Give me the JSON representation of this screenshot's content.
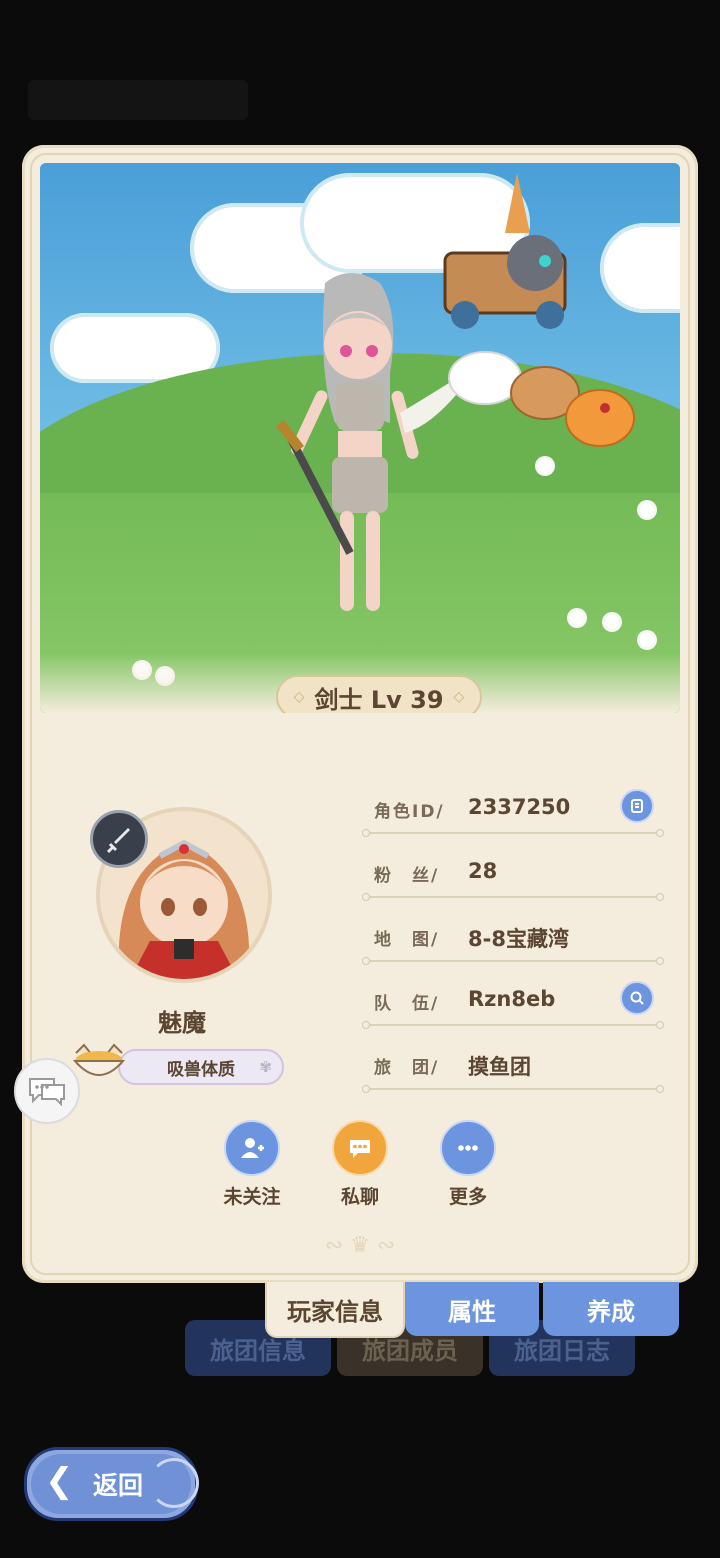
{
  "background": {
    "tabs": [
      "旅团信息",
      "旅团成员",
      "旅团日志"
    ]
  },
  "scene": {
    "level_badge": "剑士 Lv 39"
  },
  "profile": {
    "name": "魅魔",
    "trait": "吸兽体质"
  },
  "info": {
    "role_id": {
      "label": "角色ID/",
      "value": "2337250"
    },
    "fans": {
      "label": "粉　丝/",
      "value": "28"
    },
    "map": {
      "label": "地　图/",
      "value": "8-8宝藏湾"
    },
    "team": {
      "label": "队　伍/",
      "value": "Rzn8eb"
    },
    "guild": {
      "label": "旅　团/",
      "value": "摸鱼团"
    }
  },
  "actions": {
    "follow": "未关注",
    "chat": "私聊",
    "more": "更多"
  },
  "tabs": {
    "player_info": "玩家信息",
    "attributes": "属性",
    "cultivation": "养成"
  },
  "back": {
    "label": "返回"
  },
  "colors": {
    "accent_blue": "#6c94df",
    "orange": "#f0a63c",
    "card": "#f4ecdd",
    "text": "#5b4533"
  }
}
